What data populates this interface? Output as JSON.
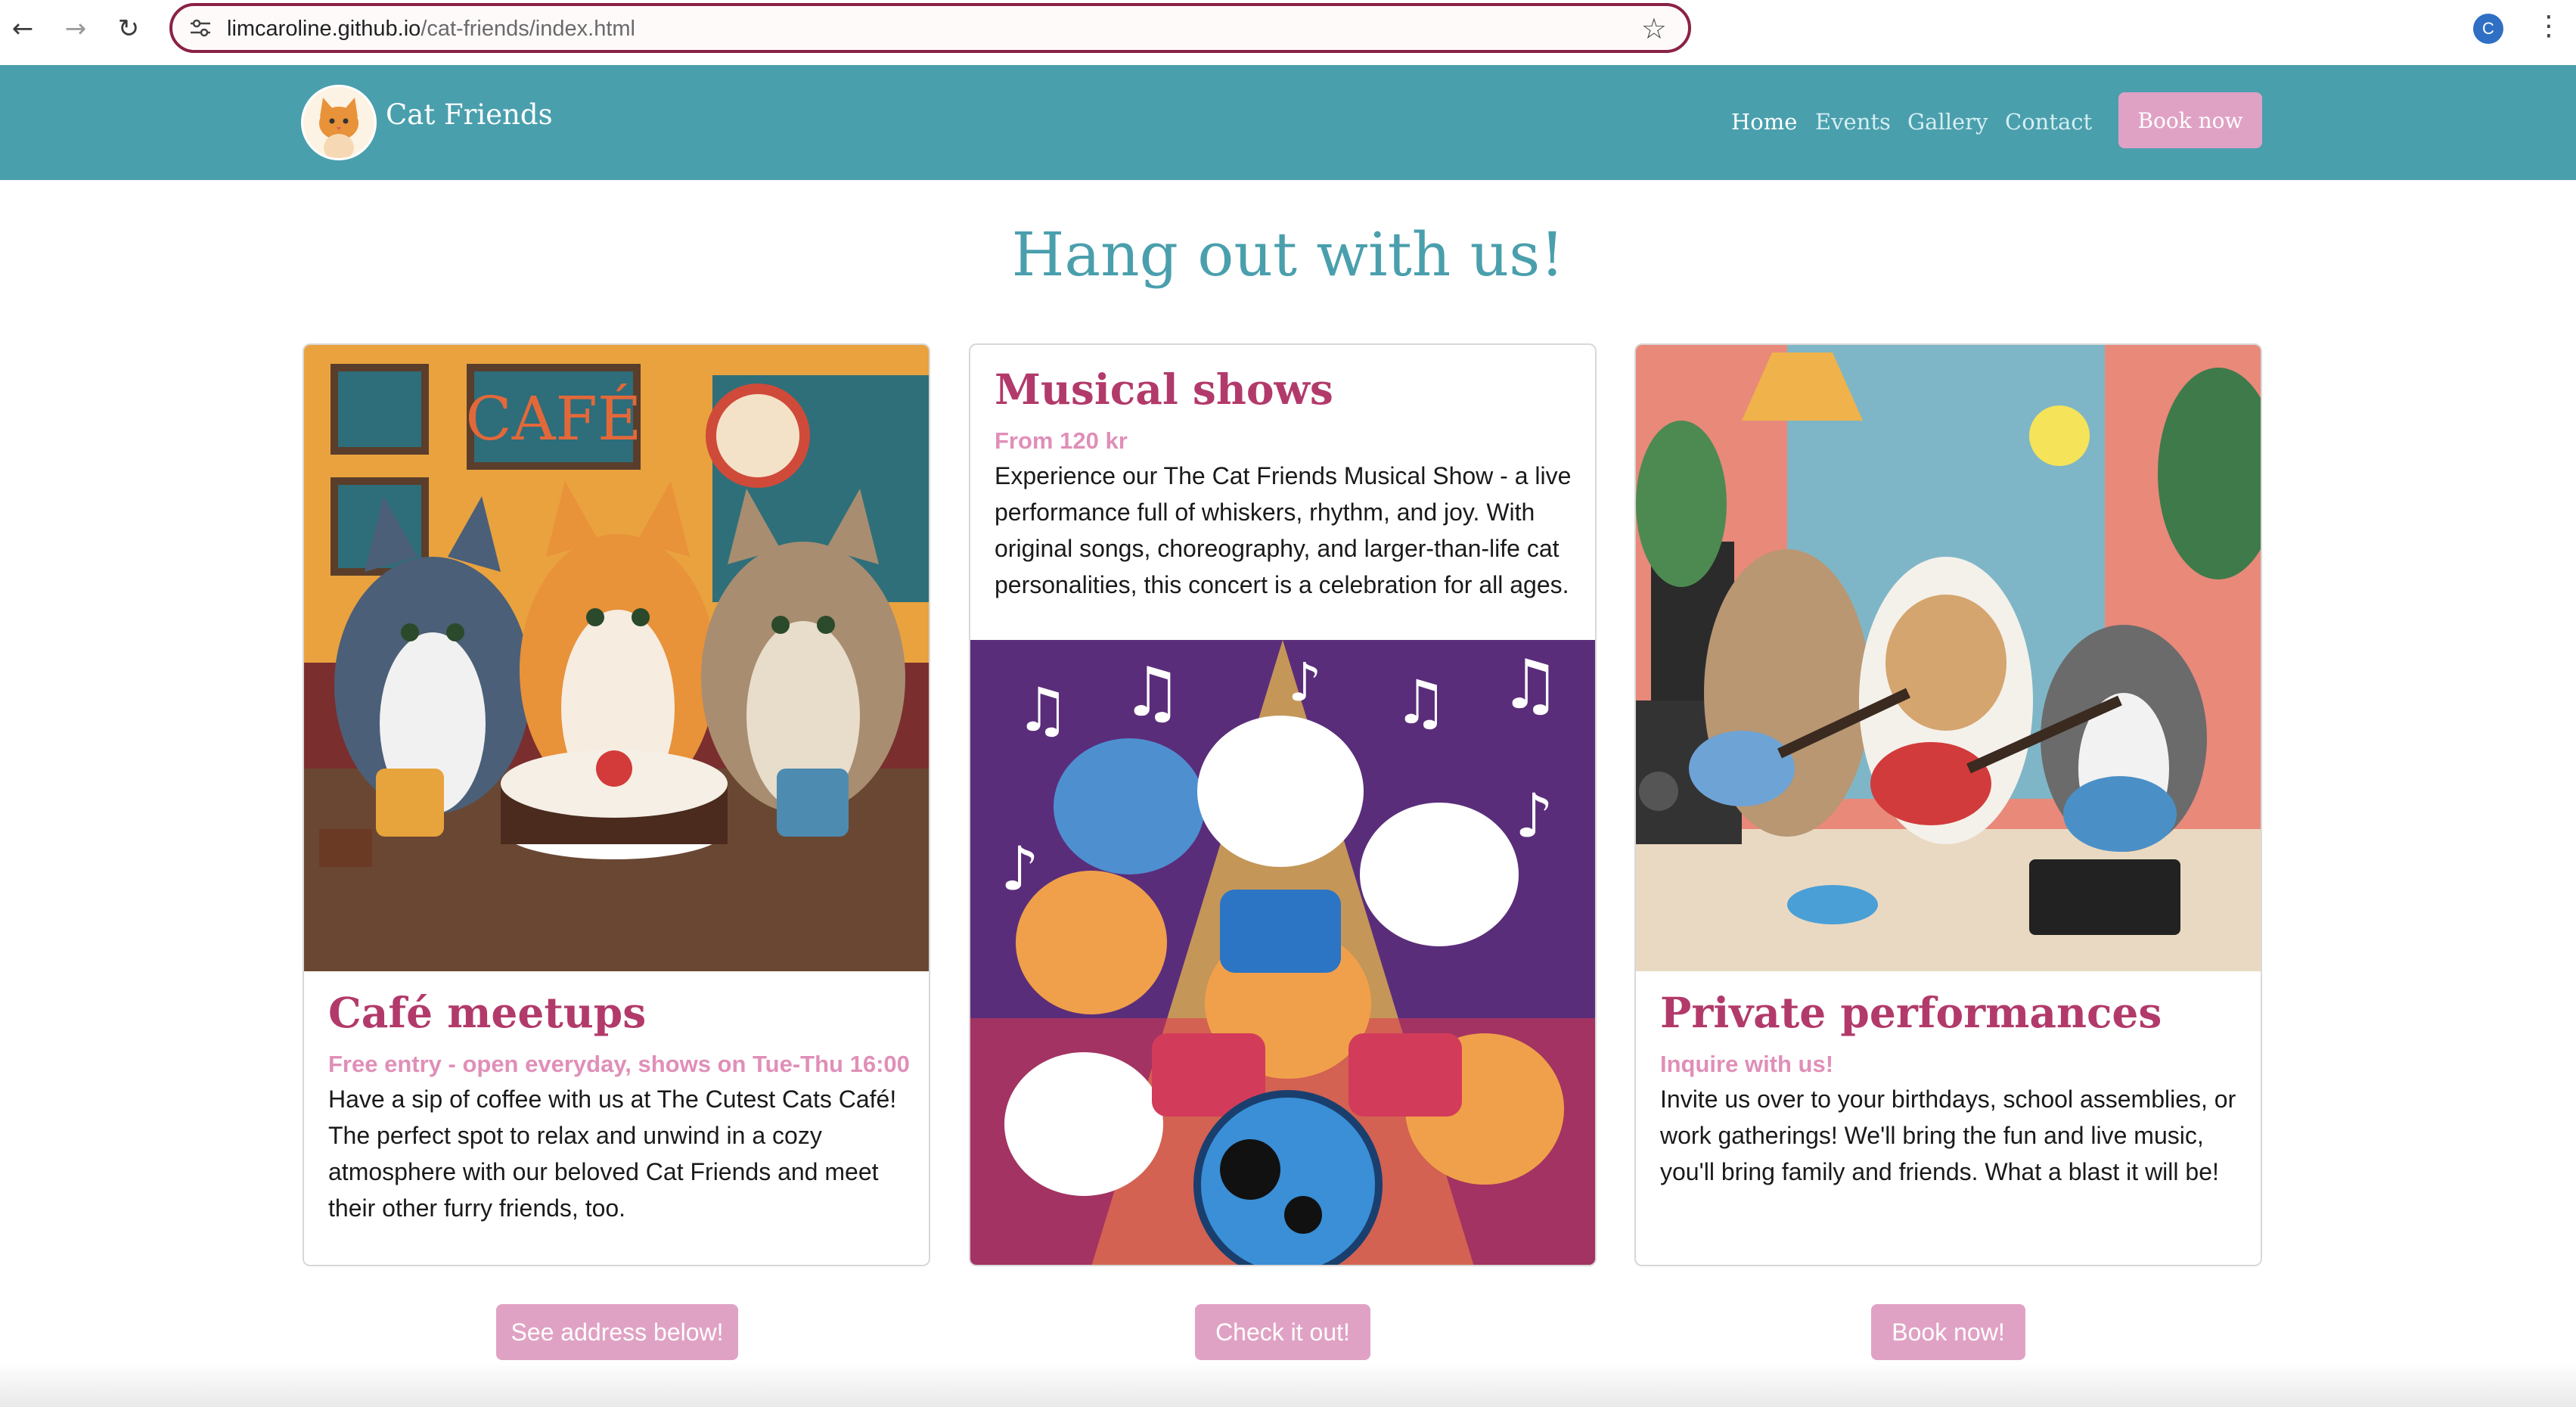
{
  "browser": {
    "url_host": "limcaroline.github.io",
    "url_path": "/cat-friends/index.html",
    "profile_initial": "C"
  },
  "site": {
    "brand": "Cat Friends",
    "nav": [
      "Home",
      "Events",
      "Gallery",
      "Contact"
    ],
    "book_label": "Book now"
  },
  "main": {
    "headline": "Hang out with us!",
    "cards": [
      {
        "title": "Café meetups",
        "subtitle": "Free entry - open everyday, shows on Tue-Thu 16:00",
        "text": "Have a sip of coffee with us at The Cutest Cats Café! The perfect spot to relax and unwind in a cozy atmosphere with our beloved Cat Friends and meet their other furry friends, too.",
        "cta": "See address below!"
      },
      {
        "title": "Musical shows",
        "subtitle": "From 120 kr",
        "text": "Experience our The Cat Friends Musical Show - a live performance full of whiskers, rhythm, and joy. With original songs, choreography, and larger-than-life cat personalities, this concert is a celebration for all ages.",
        "cta": "Check it out!"
      },
      {
        "title": "Private performances",
        "subtitle": "Inquire with us!",
        "text": "Invite us over to your birthdays, school assemblies, or work gatherings! We'll bring the fun and live music, you'll bring family and friends. What a blast it will be!",
        "cta": "Book now!"
      }
    ]
  },
  "colors": {
    "header": "#4a9fad",
    "accent_pink": "#e0a2c4",
    "title_pink": "#b23a6b",
    "subtitle_pink": "#e08fb8"
  }
}
